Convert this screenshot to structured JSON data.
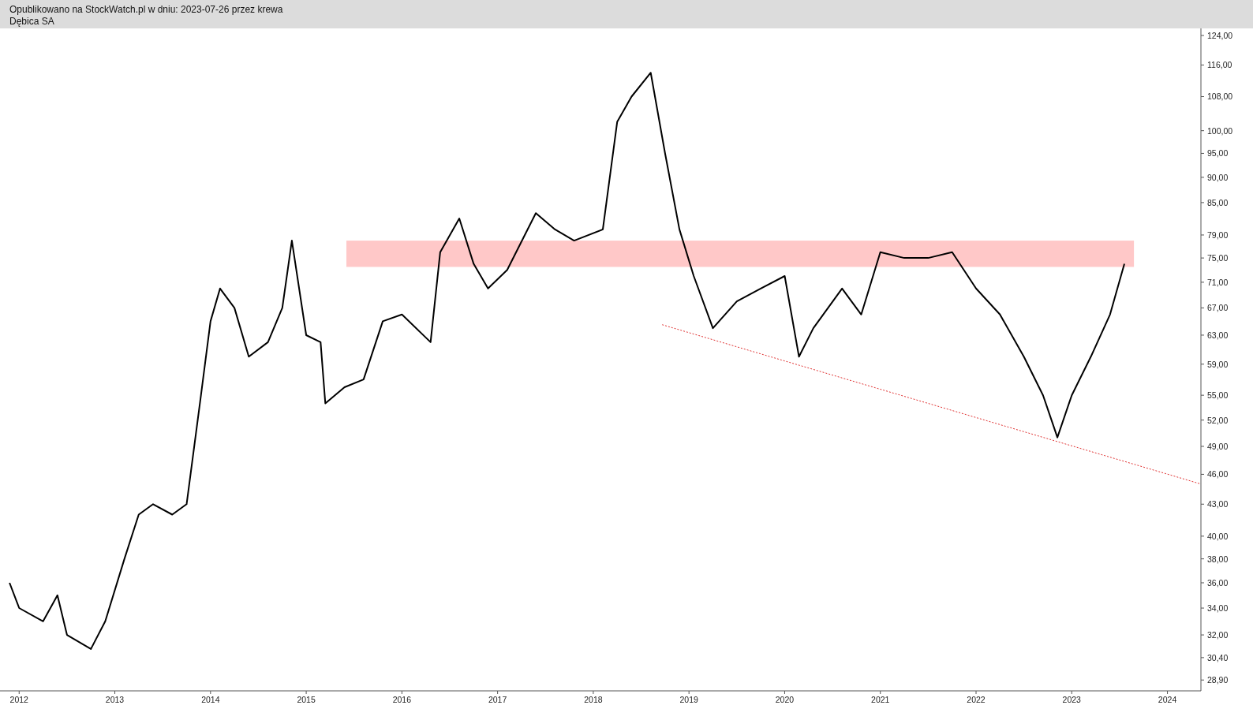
{
  "header": {
    "published": "Opublikowano na StockWatch.pl w dniu: 2023-07-26 przez krewa",
    "instrument": "Dębica SA"
  },
  "time_axis": {
    "labels": [
      "2012",
      "2013",
      "2014",
      "2015",
      "2016",
      "2017",
      "2018",
      "2019",
      "2020",
      "2021",
      "2022",
      "2023",
      "2024"
    ]
  },
  "price_axis": {
    "labels": [
      "124,00",
      "116,00",
      "108,00",
      "100,00",
      "95,00",
      "90,00",
      "85,00",
      "79,00",
      "75,00",
      "71,00",
      "67,00",
      "63,00",
      "59,00",
      "55,00",
      "52,00",
      "49,00",
      "46,00",
      "43,00",
      "40,00",
      "38,00",
      "36,00",
      "34,00",
      "32,00",
      "30,40",
      "28,90"
    ]
  }
}
